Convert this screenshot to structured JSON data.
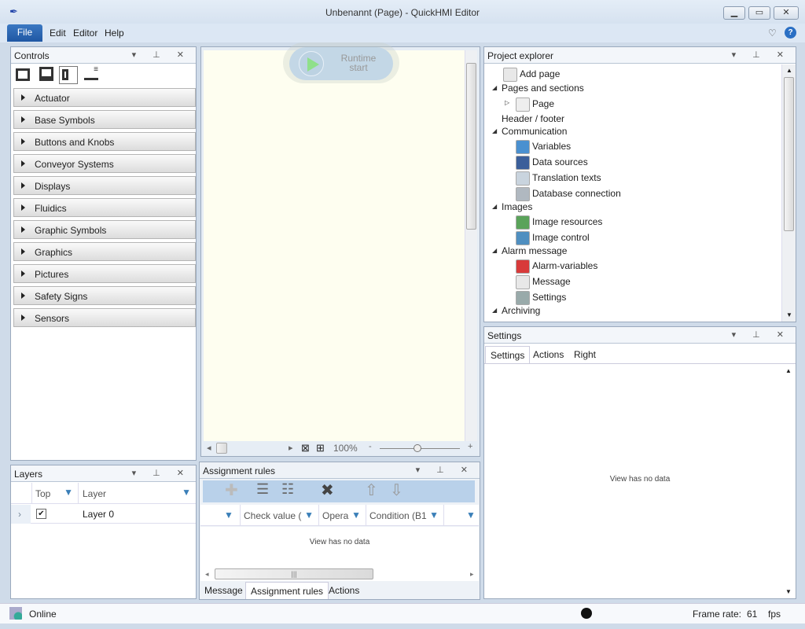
{
  "window": {
    "title": "Unbenannt (Page) - QuickHMI Editor",
    "buttons": [
      "minimize",
      "maximize",
      "close"
    ]
  },
  "menu": {
    "items": [
      "File",
      "Edit",
      "Editor",
      "Help"
    ]
  },
  "controls": {
    "title": "Controls",
    "view_modes": [
      "box-view-icon",
      "box-caption-view-icon",
      "list-view-icon",
      "text-view-icon"
    ],
    "categories": [
      "Actuator",
      "Base Symbols",
      "Buttons and Knobs",
      "Conveyor Systems",
      "Displays",
      "Fluidics",
      "Graphic Symbols",
      "Graphics",
      "Pictures",
      "Safety Signs",
      "Sensors"
    ]
  },
  "layers": {
    "title": "Layers",
    "columns": [
      "Top",
      "Layer"
    ],
    "rows": [
      {
        "top": true,
        "layer": "Layer 0"
      }
    ]
  },
  "canvas": {
    "runtime_label_1": "Runtime",
    "runtime_label_2": "start",
    "zoom": "100%",
    "zoom_minus": "-",
    "zoom_plus": "+",
    "background": "#fefef0"
  },
  "assignment": {
    "title": "Assignment rules",
    "columns": [
      "Check value (",
      "Opera",
      "Condition (B1",
      ""
    ],
    "empty": "View has no data",
    "tabs": [
      "Message",
      "Assignment rules",
      "Actions"
    ],
    "active_tab": "Assignment rules"
  },
  "explorer": {
    "title": "Project explorer",
    "items": [
      {
        "label": "Add page",
        "level": 1,
        "icon": "add-page-icon",
        "exp": ""
      },
      {
        "label": "Pages and sections",
        "level": 0,
        "icon": "",
        "exp": "▲"
      },
      {
        "label": "Page",
        "level": 2,
        "icon": "page-icon",
        "exp": "▷"
      },
      {
        "label": "Header / footer",
        "level": 0,
        "icon": "",
        "exp": ""
      },
      {
        "label": "Communication",
        "level": 0,
        "icon": "",
        "exp": "▲"
      },
      {
        "label": "Variables",
        "level": 2,
        "icon": "variables-icon",
        "exp": ""
      },
      {
        "label": "Data sources",
        "level": 2,
        "icon": "data-sources-icon",
        "exp": ""
      },
      {
        "label": "Translation texts",
        "level": 2,
        "icon": "translation-icon",
        "exp": ""
      },
      {
        "label": "Database connection",
        "level": 2,
        "icon": "database-icon",
        "exp": ""
      },
      {
        "label": "Images",
        "level": 0,
        "icon": "",
        "exp": "▲"
      },
      {
        "label": "Image resources",
        "level": 2,
        "icon": "image-resources-icon",
        "exp": ""
      },
      {
        "label": "Image control",
        "level": 2,
        "icon": "image-control-icon",
        "exp": ""
      },
      {
        "label": "Alarm message",
        "level": 0,
        "icon": "",
        "exp": "▲"
      },
      {
        "label": "Alarm-variables",
        "level": 2,
        "icon": "alarm-variables-icon",
        "exp": ""
      },
      {
        "label": "Message",
        "level": 2,
        "icon": "message-icon",
        "exp": ""
      },
      {
        "label": "Settings",
        "level": 2,
        "icon": "settings-gear-icon",
        "exp": ""
      },
      {
        "label": "Archiving",
        "level": 0,
        "icon": "",
        "exp": "▲"
      }
    ]
  },
  "settings": {
    "title": "Settings",
    "tabs": [
      "Settings",
      "Actions",
      "Right"
    ],
    "active_tab": "Settings",
    "empty": "View has no data"
  },
  "status": {
    "connection": "Online",
    "frame_rate_label": "Frame rate:",
    "frame_rate": "61",
    "fps": "fps"
  }
}
